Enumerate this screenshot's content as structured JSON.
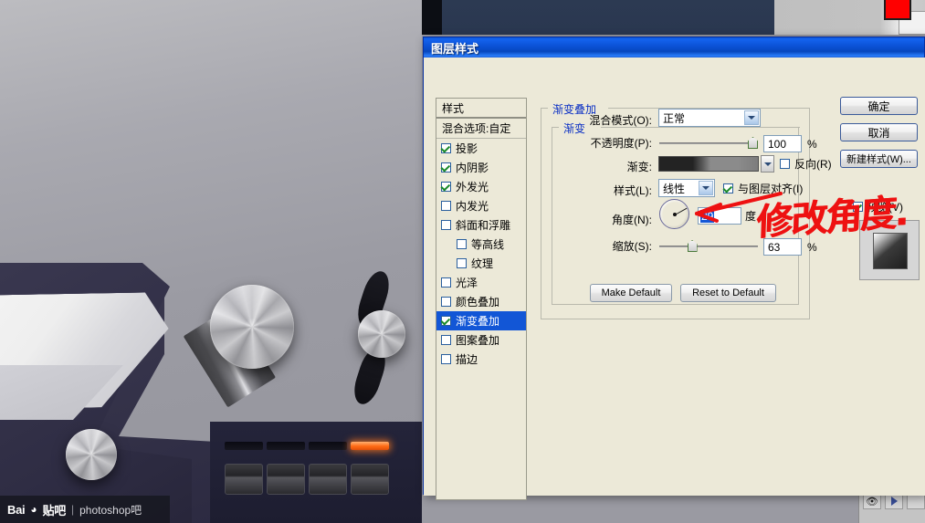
{
  "app": {
    "background_label": "photoshop-canvas"
  },
  "watermark": {
    "brand": "Bai",
    "paw": "◕",
    "brand2": "贴吧",
    "separator": "|",
    "text": "photoshop吧"
  },
  "dialog": {
    "title": "图层样式",
    "styles_panel": {
      "header": "样式",
      "blending_options": "混合选项:自定",
      "items": [
        {
          "label": "投影",
          "checked": true,
          "indent": false,
          "selected": false
        },
        {
          "label": "内阴影",
          "checked": true,
          "indent": false,
          "selected": false
        },
        {
          "label": "外发光",
          "checked": true,
          "indent": false,
          "selected": false
        },
        {
          "label": "内发光",
          "checked": false,
          "indent": false,
          "selected": false
        },
        {
          "label": "斜面和浮雕",
          "checked": false,
          "indent": false,
          "selected": false
        },
        {
          "label": "等高线",
          "checked": false,
          "indent": true,
          "selected": false
        },
        {
          "label": "纹理",
          "checked": false,
          "indent": true,
          "selected": false
        },
        {
          "label": "光泽",
          "checked": false,
          "indent": false,
          "selected": false
        },
        {
          "label": "颜色叠加",
          "checked": false,
          "indent": false,
          "selected": false
        },
        {
          "label": "渐变叠加",
          "checked": true,
          "indent": false,
          "selected": true
        },
        {
          "label": "图案叠加",
          "checked": false,
          "indent": false,
          "selected": false
        },
        {
          "label": "描边",
          "checked": false,
          "indent": false,
          "selected": false
        }
      ]
    },
    "main": {
      "group_title": "渐变叠加",
      "subgroup_title": "渐变",
      "blend_mode": {
        "label": "混合模式(O):",
        "value": "正常"
      },
      "opacity": {
        "label": "不透明度(P):",
        "value": "100",
        "unit": "%",
        "percent": 100
      },
      "gradient": {
        "label": "渐变:",
        "reverse_label": "反向(R)",
        "reverse_checked": false,
        "stop_start": "#232323",
        "stop_end": "#8b8b8b"
      },
      "style": {
        "label": "样式(L):",
        "value": "线性",
        "align_label": "与图层对齐(I)",
        "align_checked": true
      },
      "angle": {
        "label": "角度(N):",
        "value": "29",
        "unit": "度",
        "degrees": 29
      },
      "scale": {
        "label": "缩放(S):",
        "value": "63",
        "unit": "%",
        "percent": 63
      },
      "make_default": "Make Default",
      "reset_default": "Reset to Default"
    },
    "right": {
      "ok": "确定",
      "cancel": "取消",
      "new_style": "新建样式(W)...",
      "preview_label": "预览(V)",
      "preview_checked": true
    }
  },
  "annotation": {
    "text": "修改角度.",
    "color": "#ee1111"
  },
  "colors": {
    "titlebar_blue": "#0a53d6",
    "selection_blue": "#1256d6",
    "dialog_face": "#ece9d8",
    "group_label_blue": "#0a2fc4",
    "foreground_swatch": "#ff0000",
    "background_swatch": "#f2f2f2",
    "led": "#ff6a14"
  }
}
